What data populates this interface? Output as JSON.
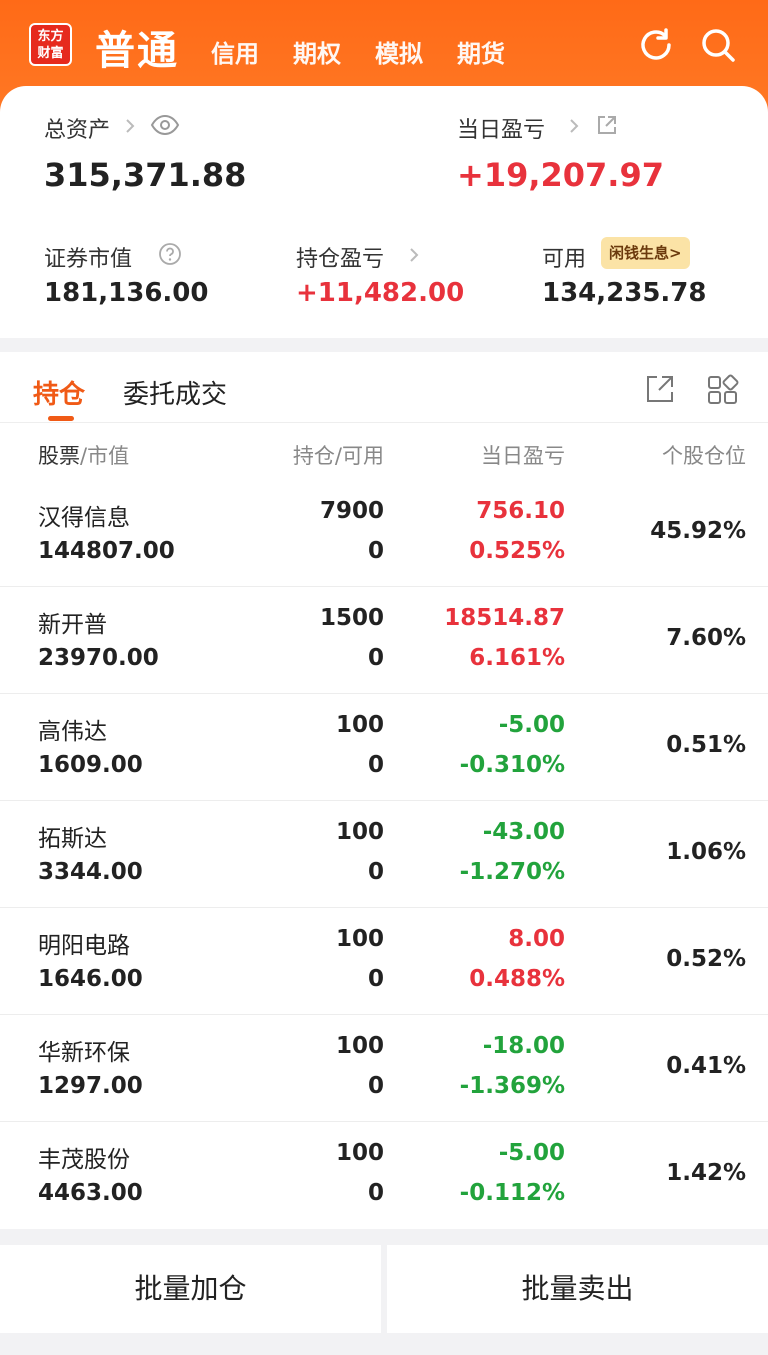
{
  "header": {
    "logo_line1": "东方",
    "logo_line2": "财富",
    "tabs": [
      {
        "label": "普通"
      },
      {
        "label": "信用"
      },
      {
        "label": "期权"
      },
      {
        "label": "模拟"
      },
      {
        "label": "期货"
      }
    ],
    "icons": [
      "refresh-icon",
      "search-icon"
    ]
  },
  "summary": {
    "total_assets_label": "总资产",
    "total_assets_value": "315,371.88",
    "daily_pl_label": "当日盈亏",
    "daily_pl_value": "+19,207.97",
    "market_value_label": "证券市值",
    "market_value_value": "181,136.00",
    "position_pl_label": "持仓盈亏",
    "position_pl_value": "+11,482.00",
    "available_label": "可用",
    "available_value": "134,235.78",
    "badge_label": "闲钱生息>"
  },
  "holdings": {
    "tabs": [
      {
        "label": "持仓"
      },
      {
        "label": "委托成交"
      }
    ],
    "columns": {
      "col1_a": "股票",
      "col1_b": "/市值",
      "col2": "持仓/可用",
      "col3": "当日盈亏",
      "col4": "个股仓位"
    },
    "rows": [
      {
        "name": "汉得信息",
        "market_value": "144807.00",
        "qty": "7900",
        "available": "0",
        "pl": "756.10",
        "pl_pct": "0.525%",
        "position": "45.92%",
        "trend": "up"
      },
      {
        "name": "新开普",
        "market_value": "23970.00",
        "qty": "1500",
        "available": "0",
        "pl": "18514.87",
        "pl_pct": "6.161%",
        "position": "7.60%",
        "trend": "up"
      },
      {
        "name": "高伟达",
        "market_value": "1609.00",
        "qty": "100",
        "available": "0",
        "pl": "-5.00",
        "pl_pct": "-0.310%",
        "position": "0.51%",
        "trend": "down"
      },
      {
        "name": "拓斯达",
        "market_value": "3344.00",
        "qty": "100",
        "available": "0",
        "pl": "-43.00",
        "pl_pct": "-1.270%",
        "position": "1.06%",
        "trend": "down"
      },
      {
        "name": "明阳电路",
        "market_value": "1646.00",
        "qty": "100",
        "available": "0",
        "pl": "8.00",
        "pl_pct": "0.488%",
        "position": "0.52%",
        "trend": "up"
      },
      {
        "name": "华新环保",
        "market_value": "1297.00",
        "qty": "100",
        "available": "0",
        "pl": "-18.00",
        "pl_pct": "-1.369%",
        "position": "0.41%",
        "trend": "down"
      },
      {
        "name": "丰茂股份",
        "market_value": "4463.00",
        "qty": "100",
        "available": "0",
        "pl": "-5.00",
        "pl_pct": "-0.112%",
        "position": "1.42%",
        "trend": "down"
      }
    ]
  },
  "actions": {
    "batch_add_label": "批量加仓",
    "batch_sell_label": "批量卖出"
  },
  "colors": {
    "brand_orange": "#ff6a17",
    "up_red": "#e8323c",
    "down_green": "#22a33c"
  }
}
